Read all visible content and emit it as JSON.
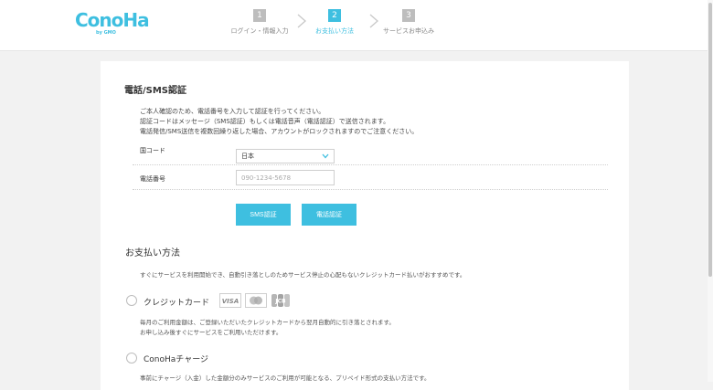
{
  "logo": {
    "text": "ConoHa",
    "sub": "by GMO"
  },
  "steps": [
    {
      "num": "1",
      "label": "ログイン・情報入力",
      "active": false
    },
    {
      "num": "2",
      "label": "お支払い方法",
      "active": true
    },
    {
      "num": "3",
      "label": "サービスお申込み",
      "active": false
    }
  ],
  "sms": {
    "title": "電話/SMS認証",
    "desc": [
      "ご本人確認のため、電話番号を入力して認証を行ってください。",
      "認証コードはメッセージ（SMS認証）もしくは電話音声（電話認証）で送信されます。",
      "電話発信/SMS送信を複数回繰り返した場合、アカウントがロックされますのでご注意ください。"
    ],
    "country_label": "国コード",
    "country_value": "日本",
    "phone_label": "電話番号",
    "phone_placeholder": "090-1234-5678",
    "sms_button": "SMS認証",
    "call_button": "電話認証"
  },
  "payment": {
    "title": "お支払い方法",
    "intro": "すぐにサービスを利用開始でき、自動引き落としのためサービス停止の心配もないクレジットカード払いがおすすめです。",
    "credit": {
      "label": "クレジットカード",
      "desc": [
        "毎月のご利用金額は、ご登録いただいたクレジットカードから翌月自動的に引き落とされます。",
        "お申し込み後すぐにサービスをご利用いただけます。"
      ],
      "card_icons": [
        "visa-icon",
        "mastercard-icon",
        "jcb-icon"
      ]
    },
    "charge": {
      "label": "ConoHaチャージ",
      "desc": "事前にチャージ（入金）した金額分のみサービスのご利用が可能となる、プリペイド形式の支払い方法です。"
    }
  },
  "colors": {
    "accent": "#3ebfe0",
    "inactive": "#bdbdbd",
    "background": "#f2f2f2"
  }
}
